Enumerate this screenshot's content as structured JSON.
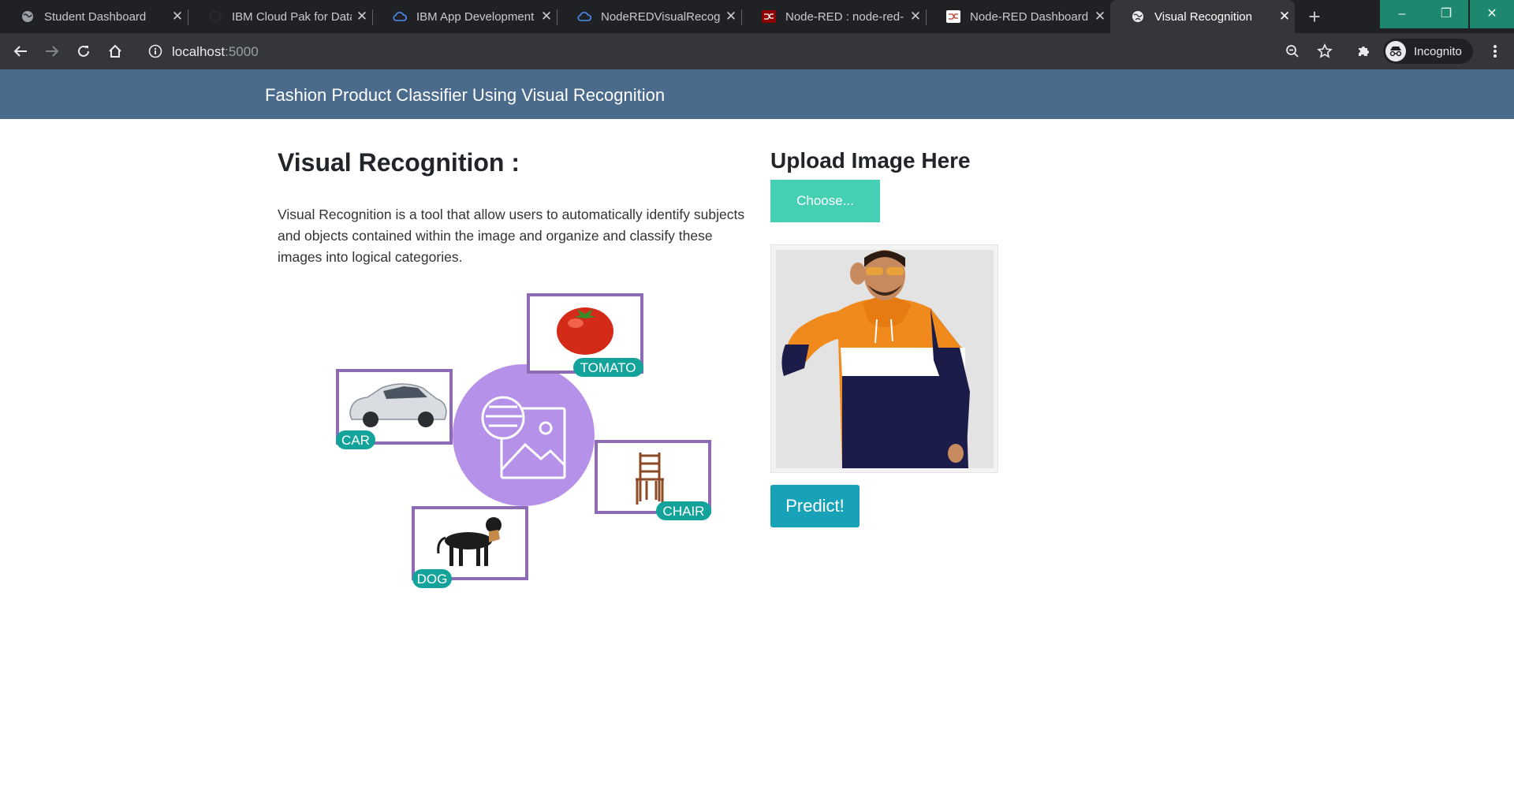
{
  "browser": {
    "tabs": [
      {
        "title": "Student Dashboard",
        "icon": "globe-icon",
        "active": false
      },
      {
        "title": "IBM Cloud Pak for Data",
        "icon": "ibm-icon",
        "active": false
      },
      {
        "title": "IBM App Development",
        "icon": "cloud-icon",
        "active": false
      },
      {
        "title": "NodeREDVisualRecogn",
        "icon": "cloud-icon",
        "active": false
      },
      {
        "title": "Node-RED : node-red-",
        "icon": "node-red-icon",
        "active": false
      },
      {
        "title": "Node-RED Dashboard",
        "icon": "node-red-icon",
        "active": false
      },
      {
        "title": "Visual Recognition",
        "icon": "globe-icon",
        "active": true
      }
    ],
    "new_tab_label": "+",
    "window_controls": {
      "minimize": "–",
      "restore": "❐",
      "close": "✕"
    },
    "url_host": "localhost",
    "url_port": ":5000",
    "profile_label": "Incognito",
    "accent_color": "#1e8770"
  },
  "page": {
    "navbar_title": "Fashion Product Classifier Using Visual Recognition",
    "left_heading": "Visual Recognition :",
    "description": "Visual Recognition is a tool that allow users to automatically identify subjects and objects contained within the image and organize and classify these images into logical categories.",
    "diagram_labels": {
      "tomato": "TOMATO",
      "car": "CAR",
      "chair": "CHAIR",
      "dog": "DOG"
    },
    "right_heading": "Upload Image Here",
    "choose_label": "Choose...",
    "predict_label": "Predict!",
    "colors": {
      "navbar": "#4a6b8c",
      "choose_button": "#45d0b4",
      "predict_button": "#18a2b7",
      "diagram_frame": "#8e6bb5",
      "diagram_circle": "#b691ea",
      "diagram_badge": "#14a39a"
    }
  }
}
